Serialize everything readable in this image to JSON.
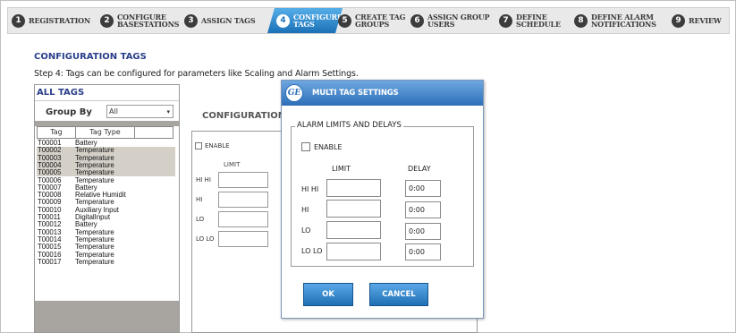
{
  "wizard": {
    "steps": [
      {
        "num": "1",
        "label": "REGISTRATION"
      },
      {
        "num": "2",
        "label": "CONFIGURE\nBASESTATIONS"
      },
      {
        "num": "3",
        "label": "ASSIGN TAGS"
      },
      {
        "num": "4",
        "label": "CONFIGURE\nTAGS",
        "active": true
      },
      {
        "num": "5",
        "label": "CREATE TAG\nGROUPS"
      },
      {
        "num": "6",
        "label": "ASSIGN GROUP\nUSERS"
      },
      {
        "num": "7",
        "label": "DEFINE\nSCHEDULE"
      },
      {
        "num": "8",
        "label": "DEFINE ALARM\nNOTIFICATIONS"
      },
      {
        "num": "9",
        "label": "REVIEW"
      }
    ]
  },
  "page": {
    "title": "CONFIGURATION TAGS",
    "instruction": "Step 4: Tags can be configured for parameters like Scaling and Alarm Settings."
  },
  "all_tags": {
    "header": "ALL TAGS",
    "group_by_label": "Group By",
    "group_by_value": "All",
    "columns": [
      "Tag",
      "Tag Type"
    ],
    "rows": [
      {
        "tag": "T00001",
        "type": "Battery",
        "selected": false
      },
      {
        "tag": "T00002",
        "type": "Temperature",
        "selected": true
      },
      {
        "tag": "T00003",
        "type": "Temperature",
        "selected": true
      },
      {
        "tag": "T00004",
        "type": "Temperature",
        "selected": true
      },
      {
        "tag": "T00005",
        "type": "Temperature",
        "selected": true
      },
      {
        "tag": "T00006",
        "type": "Temperature",
        "selected": false
      },
      {
        "tag": "T00007",
        "type": "Battery",
        "selected": false
      },
      {
        "tag": "T00008",
        "type": "Relative Humidit",
        "selected": false
      },
      {
        "tag": "T00009",
        "type": "Temperature",
        "selected": false
      },
      {
        "tag": "T00010",
        "type": "Auxiliary Input",
        "selected": false
      },
      {
        "tag": "T00011",
        "type": "DigitalInput",
        "selected": false
      },
      {
        "tag": "T00012",
        "type": "Battery",
        "selected": false
      },
      {
        "tag": "T00013",
        "type": "Temperature",
        "selected": false
      },
      {
        "tag": "T00014",
        "type": "Temperature",
        "selected": false
      },
      {
        "tag": "T00015",
        "type": "Temperature",
        "selected": false
      },
      {
        "tag": "T00016",
        "type": "Temperature",
        "selected": false
      },
      {
        "tag": "T00017",
        "type": "Temperature",
        "selected": false
      }
    ]
  },
  "background_config": {
    "title": "CONFIGURATION",
    "enable_label": "ENABLE",
    "limit_header": "LIMIT",
    "rows": [
      "HI HI",
      "HI",
      "LO",
      "LO LO"
    ]
  },
  "modal": {
    "title": "MULTI TAG SETTINGS",
    "logo_text": "GE",
    "fieldset_legend": "ALARM LIMITS AND DELAYS",
    "enable_label": "ENABLE",
    "limit_header": "LIMIT",
    "delay_header": "DELAY",
    "rows": [
      {
        "label": "HI HI",
        "limit": "",
        "delay": "0:00"
      },
      {
        "label": "HI",
        "limit": "",
        "delay": "0:00"
      },
      {
        "label": "LO",
        "limit": "",
        "delay": "0:00"
      },
      {
        "label": "LO LO",
        "limit": "",
        "delay": "0:00"
      }
    ],
    "ok_label": "OK",
    "cancel_label": "CANCEL"
  },
  "colors": {
    "accent": "#1e73b8",
    "heading": "#2a3f8a",
    "selected_row": "#d4d0c8"
  }
}
